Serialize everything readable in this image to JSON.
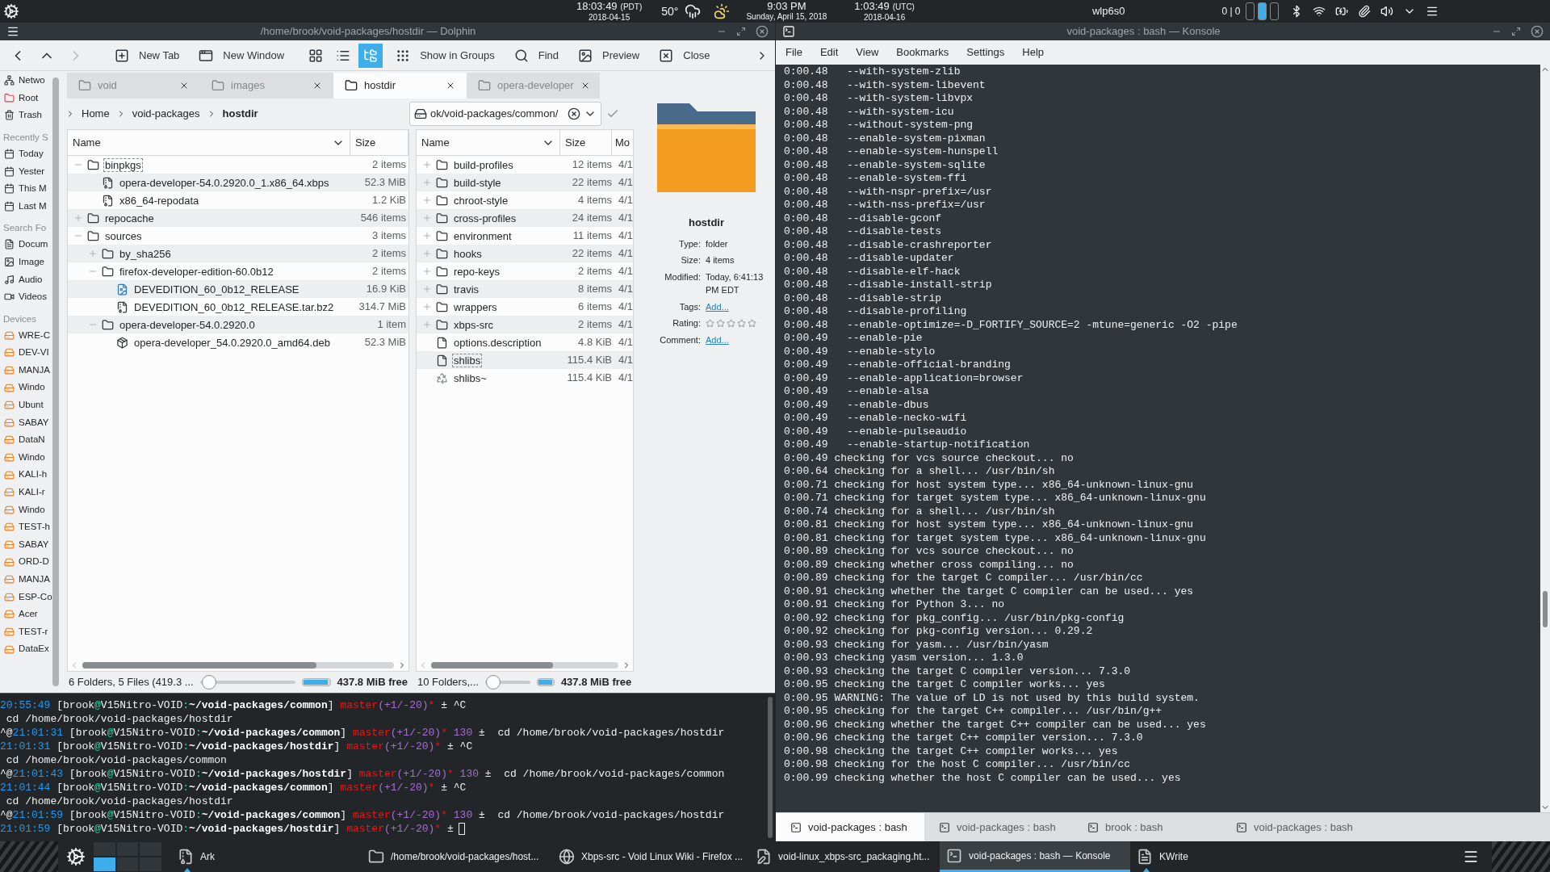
{
  "top_panel": {
    "clocks": [
      {
        "time": "18:03:49",
        "zone": "(PDT)",
        "date": "2018-04-15"
      },
      {
        "time": "9:03 PM",
        "date": "Sunday, April 15, 2018"
      },
      {
        "time": "1:03:49",
        "zone": "(UTC)",
        "date": "2018-04-16"
      }
    ],
    "weather": {
      "temperature": "50°"
    },
    "network": {
      "interface": "wlp6s0",
      "traffic": "0 | 0"
    },
    "pager": [
      {
        "selected": false
      },
      {
        "selected": true
      },
      {
        "selected": false
      }
    ]
  },
  "dolphin": {
    "title": "/home/brook/void-packages/hostdir — Dolphin",
    "nav": [
      {
        "kind": "back",
        "disabled": false
      },
      {
        "kind": "up",
        "disabled": false
      },
      {
        "kind": "forward",
        "disabled": true
      }
    ],
    "actions": [
      {
        "kind": "new_tab",
        "label": "New Tab"
      },
      {
        "kind": "new_window",
        "label": "New Window"
      }
    ],
    "view_modes": [
      {
        "kind": "icons",
        "selected": false
      },
      {
        "kind": "compact",
        "selected": false
      },
      {
        "kind": "tree",
        "selected": true
      }
    ],
    "actions_after": [
      {
        "kind": "groups",
        "label": "Show in Groups"
      },
      {
        "kind": "find",
        "label": "Find"
      },
      {
        "kind": "preview",
        "label": "Preview"
      },
      {
        "kind": "close",
        "label": "Close"
      }
    ],
    "sidebar": [
      {
        "items": [
          {
            "kind": "network",
            "label": "Netwo"
          },
          {
            "kind": "root",
            "label": "Root"
          },
          {
            "kind": "trash",
            "label": "Trash"
          }
        ]
      },
      {
        "heading": "Recently S",
        "items": [
          {
            "kind": "date",
            "label": "Today"
          },
          {
            "kind": "date",
            "label": "Yester"
          },
          {
            "kind": "date",
            "label": "This M"
          },
          {
            "kind": "date",
            "label": "Last M"
          }
        ]
      },
      {
        "heading": "Search Fo",
        "items": [
          {
            "kind": "documents",
            "label": "Docum"
          },
          {
            "kind": "images",
            "label": "Image"
          },
          {
            "kind": "audio",
            "label": "Audio"
          },
          {
            "kind": "videos",
            "label": "Videos"
          }
        ]
      },
      {
        "heading": "Devices",
        "items": [
          {
            "kind": "drive",
            "label": "WRE-C"
          },
          {
            "kind": "drive",
            "label": "DEV-VI"
          },
          {
            "kind": "drive",
            "label": "MANJA"
          },
          {
            "kind": "drive",
            "label": "Windo"
          },
          {
            "kind": "drive",
            "label": "Ubunt"
          },
          {
            "kind": "drive",
            "label": "SABAY"
          },
          {
            "kind": "drive",
            "label": "DataN"
          },
          {
            "kind": "drive",
            "label": "Windo"
          },
          {
            "kind": "drive",
            "label": "KALI-h"
          },
          {
            "kind": "drive",
            "label": "KALI-r"
          },
          {
            "kind": "drive",
            "label": "Windo"
          },
          {
            "kind": "drive",
            "label": "TEST-h"
          },
          {
            "kind": "drive",
            "label": "SABAY"
          },
          {
            "kind": "drive",
            "label": "ORD-D"
          },
          {
            "kind": "drive",
            "label": "MANJA"
          },
          {
            "kind": "drive",
            "label": "ESP-Co"
          },
          {
            "kind": "drive",
            "label": "Acer"
          },
          {
            "kind": "drive",
            "label": "TEST-r"
          },
          {
            "kind": "drive",
            "label": "DataEx"
          }
        ]
      }
    ],
    "tabs": [
      {
        "label": "void",
        "selected": false
      },
      {
        "label": "images",
        "selected": false
      },
      {
        "label": "hostdir",
        "selected": true
      },
      {
        "label": "opera-developer",
        "selected": false
      }
    ],
    "left_pane": {
      "breadcrumb": [
        {
          "label": "Home",
          "current": false
        },
        {
          "label": "void-packages",
          "current": false
        },
        {
          "label": "hostdir",
          "current": true
        }
      ],
      "columns": [
        "Name",
        "Size"
      ],
      "rows": [
        {
          "kind": "folder",
          "name": "binpkgs",
          "size": "2 items",
          "expanded": true,
          "focused": true,
          "children": [
            {
              "kind": "archive",
              "name": "opera-developer-54.0.2920.0_1.x86_64.xbps",
              "size": "52.3 MiB",
              "focused": false
            },
            {
              "kind": "archive",
              "name": "x86_64-repodata",
              "size": "1.2 KiB",
              "focused": false
            }
          ]
        },
        {
          "kind": "folder",
          "name": "repocache",
          "size": "546 items",
          "expanded": false,
          "focused": false
        },
        {
          "kind": "folder",
          "name": "sources",
          "size": "3 items",
          "expanded": true,
          "focused": false,
          "children": [
            {
              "kind": "folder",
              "name": "by_sha256",
              "size": "2 items",
              "expanded": false,
              "focused": false
            },
            {
              "kind": "folder",
              "name": "firefox-developer-edition-60.0b12",
              "size": "2 items",
              "expanded": true,
              "focused": false,
              "children": [
                {
                  "kind": "image",
                  "name": "DEVEDITION_60_0b12_RELEASE",
                  "size": "16.9 KiB",
                  "focused": false
                },
                {
                  "kind": "archive",
                  "name": "DEVEDITION_60_0b12_RELEASE.tar.bz2",
                  "size": "314.7 MiB",
                  "focused": false
                }
              ]
            },
            {
              "kind": "folder",
              "name": "opera-developer-54.0.2920.0",
              "size": "1 item",
              "expanded": true,
              "focused": false,
              "children": [
                {
                  "kind": "package",
                  "name": "opera-developer_54.0.2920.0_amd64.deb",
                  "size": "52.3 MiB",
                  "focused": false
                }
              ]
            }
          ]
        }
      ],
      "status": {
        "text": "6 Folders, 5 Files (419.3 ...",
        "zoom_slider": {
          "level": 0.02
        },
        "free_space": {
          "text": "437.8 MiB free",
          "level": 0.96
        }
      }
    },
    "right_pane": {
      "location": "ok/void-packages/common/",
      "columns": [
        "Name",
        "Size",
        "Mo"
      ],
      "rows": [
        {
          "kind": "folder",
          "name": "build-profiles",
          "size": "12 items",
          "modified": "4/1",
          "expanded": false,
          "focused": false
        },
        {
          "kind": "folder",
          "name": "build-style",
          "size": "22 items",
          "modified": "4/1",
          "expanded": false,
          "focused": false
        },
        {
          "kind": "folder",
          "name": "chroot-style",
          "size": "4 items",
          "modified": "4/1",
          "expanded": false,
          "focused": false
        },
        {
          "kind": "folder",
          "name": "cross-profiles",
          "size": "24 items",
          "modified": "4/1",
          "expanded": false,
          "focused": false
        },
        {
          "kind": "folder",
          "name": "environment",
          "size": "11 items",
          "modified": "4/1",
          "expanded": false,
          "focused": false
        },
        {
          "kind": "folder",
          "name": "hooks",
          "size": "22 items",
          "modified": "4/1",
          "expanded": false,
          "focused": false
        },
        {
          "kind": "folder",
          "name": "repo-keys",
          "size": "2 items",
          "modified": "4/1",
          "expanded": false,
          "focused": false
        },
        {
          "kind": "folder",
          "name": "travis",
          "size": "8 items",
          "modified": "4/1",
          "expanded": false,
          "focused": false
        },
        {
          "kind": "folder",
          "name": "wrappers",
          "size": "6 items",
          "modified": "4/1",
          "expanded": false,
          "focused": false
        },
        {
          "kind": "folder",
          "name": "xbps-src",
          "size": "2 items",
          "modified": "4/1",
          "expanded": false,
          "focused": false
        },
        {
          "kind": "file",
          "name": "options.description",
          "size": "4.8 KiB",
          "modified": "4/1",
          "focused": false
        },
        {
          "kind": "file",
          "name": "shlibs",
          "size": "115.4 KiB",
          "modified": "4/1",
          "focused": true
        },
        {
          "kind": "backup",
          "name": "shlibs~",
          "size": "115.4 KiB",
          "modified": "4/1",
          "focused": false
        }
      ],
      "status": {
        "text": "10 Folders,...",
        "zoom_slider": {
          "level": 0.02
        },
        "free_space": {
          "text": "437.8 MiB free",
          "level": 0.96
        }
      }
    },
    "info": {
      "name": "hostdir",
      "fields": [
        {
          "kind": "text",
          "label": "Type:",
          "value": "folder"
        },
        {
          "kind": "text",
          "label": "Size:",
          "value": "4 items"
        },
        {
          "kind": "text",
          "label": "Modified:",
          "value": "Today, 6:41:13 PM EDT"
        },
        {
          "kind": "link",
          "label": "Tags:",
          "value": "Add..."
        },
        {
          "kind": "rating",
          "label": "Rating:",
          "stars": 0
        },
        {
          "kind": "link",
          "label": "Comment:",
          "value": "Add..."
        }
      ]
    },
    "terminal": {
      "cursor_visible": true,
      "lines": [
        {
          "segments": [
            {
              "kind": "time",
              "text": "20:55:49"
            },
            {
              "kind": "plain",
              "text": " [brook"
            },
            {
              "kind": "accent",
              "text": "@"
            },
            {
              "kind": "plain",
              "text": "V15Nitro-VOID"
            },
            {
              "kind": "accent",
              "text": ":"
            },
            {
              "kind": "path",
              "text": "~/void-packages/common"
            },
            {
              "kind": "plain",
              "text": "] "
            },
            {
              "kind": "git",
              "text": "master"
            },
            {
              "kind": "diff",
              "text": "(+1/-20)"
            },
            {
              "kind": "git",
              "text": "*"
            },
            {
              "kind": "plain",
              "text": " ± ^C"
            }
          ]
        },
        {
          "segments": [
            {
              "kind": "plain",
              "text": " cd /home/brook/void-packages/hostdir"
            }
          ]
        },
        {
          "segments": [
            {
              "kind": "plain",
              "text": "^@"
            },
            {
              "kind": "time",
              "text": "21:01:31"
            },
            {
              "kind": "plain",
              "text": " [brook"
            },
            {
              "kind": "accent",
              "text": "@"
            },
            {
              "kind": "plain",
              "text": "V15Nitro-VOID"
            },
            {
              "kind": "accent",
              "text": ":"
            },
            {
              "kind": "path",
              "text": "~/void-packages/common"
            },
            {
              "kind": "plain",
              "text": "] "
            },
            {
              "kind": "git",
              "text": "master"
            },
            {
              "kind": "diff",
              "text": "(+1/-20)"
            },
            {
              "kind": "git",
              "text": "*"
            },
            {
              "kind": "diff",
              "text": " 130"
            },
            {
              "kind": "plain",
              "text": " ±  cd /home/brook/void-packages/hostdir"
            }
          ]
        },
        {
          "segments": [
            {
              "kind": "time",
              "text": "21:01:31"
            },
            {
              "kind": "plain",
              "text": " [brook"
            },
            {
              "kind": "accent",
              "text": "@"
            },
            {
              "kind": "plain",
              "text": "V15Nitro-VOID"
            },
            {
              "kind": "accent",
              "text": ":"
            },
            {
              "kind": "path",
              "text": "~/void-packages/hostdir"
            },
            {
              "kind": "plain",
              "text": "] "
            },
            {
              "kind": "git",
              "text": "master"
            },
            {
              "kind": "diff",
              "text": "(+1/-20)"
            },
            {
              "kind": "git",
              "text": "*"
            },
            {
              "kind": "plain",
              "text": " ± ^C"
            }
          ]
        },
        {
          "segments": [
            {
              "kind": "plain",
              "text": " cd /home/brook/void-packages/common"
            }
          ]
        },
        {
          "segments": [
            {
              "kind": "plain",
              "text": "^@"
            },
            {
              "kind": "time",
              "text": "21:01:43"
            },
            {
              "kind": "plain",
              "text": " [brook"
            },
            {
              "kind": "accent",
              "text": "@"
            },
            {
              "kind": "plain",
              "text": "V15Nitro-VOID"
            },
            {
              "kind": "accent",
              "text": ":"
            },
            {
              "kind": "path",
              "text": "~/void-packages/hostdir"
            },
            {
              "kind": "plain",
              "text": "] "
            },
            {
              "kind": "git",
              "text": "master"
            },
            {
              "kind": "diff",
              "text": "(+1/-20)"
            },
            {
              "kind": "git",
              "text": "*"
            },
            {
              "kind": "diff",
              "text": " 130"
            },
            {
              "kind": "plain",
              "text": " ±  cd /home/brook/void-packages/common"
            }
          ]
        },
        {
          "segments": [
            {
              "kind": "time",
              "text": "21:01:44"
            },
            {
              "kind": "plain",
              "text": " [brook"
            },
            {
              "kind": "accent",
              "text": "@"
            },
            {
              "kind": "plain",
              "text": "V15Nitro-VOID"
            },
            {
              "kind": "accent",
              "text": ":"
            },
            {
              "kind": "path",
              "text": "~/void-packages/common"
            },
            {
              "kind": "plain",
              "text": "] "
            },
            {
              "kind": "git",
              "text": "master"
            },
            {
              "kind": "diff",
              "text": "(+1/-20)"
            },
            {
              "kind": "git",
              "text": "*"
            },
            {
              "kind": "plain",
              "text": " ± ^C"
            }
          ]
        },
        {
          "segments": [
            {
              "kind": "plain",
              "text": " cd /home/brook/void-packages/hostdir"
            }
          ]
        },
        {
          "segments": [
            {
              "kind": "plain",
              "text": "^@"
            },
            {
              "kind": "time",
              "text": "21:01:59"
            },
            {
              "kind": "plain",
              "text": " [brook"
            },
            {
              "kind": "accent",
              "text": "@"
            },
            {
              "kind": "plain",
              "text": "V15Nitro-VOID"
            },
            {
              "kind": "accent",
              "text": ":"
            },
            {
              "kind": "path",
              "text": "~/void-packages/common"
            },
            {
              "kind": "plain",
              "text": "] "
            },
            {
              "kind": "git",
              "text": "master"
            },
            {
              "kind": "diff",
              "text": "(+1/-20)"
            },
            {
              "kind": "git",
              "text": "*"
            },
            {
              "kind": "diff",
              "text": " 130"
            },
            {
              "kind": "plain",
              "text": " ±  cd /home/brook/void-packages/hostdir"
            }
          ]
        },
        {
          "segments": [
            {
              "kind": "time",
              "text": "21:01:59"
            },
            {
              "kind": "plain",
              "text": " [brook"
            },
            {
              "kind": "accent",
              "text": "@"
            },
            {
              "kind": "plain",
              "text": "V15Nitro-VOID"
            },
            {
              "kind": "accent",
              "text": ":"
            },
            {
              "kind": "path",
              "text": "~/void-packages/hostdir"
            },
            {
              "kind": "plain",
              "text": "] "
            },
            {
              "kind": "git",
              "text": "master"
            },
            {
              "kind": "diff",
              "text": "(+1/-20)"
            },
            {
              "kind": "git",
              "text": "*"
            },
            {
              "kind": "plain",
              "text": " ±"
            }
          ]
        }
      ]
    }
  },
  "konsole": {
    "title": "void-packages : bash — Konsole",
    "menu": [
      "File",
      "Edit",
      "View",
      "Bookmarks",
      "Settings",
      "Help"
    ],
    "lines": [
      "0:00.48   --with-system-zlib",
      "0:00.48   --with-system-libevent",
      "0:00.48   --with-system-libvpx",
      "0:00.48   --with-system-icu",
      "0:00.48   --without-system-png",
      "0:00.48   --enable-system-pixman",
      "0:00.48   --enable-system-hunspell",
      "0:00.48   --enable-system-sqlite",
      "0:00.48   --enable-system-ffi",
      "0:00.48   --with-nspr-prefix=/usr",
      "0:00.48   --with-nss-prefix=/usr",
      "0:00.48   --disable-gconf",
      "0:00.48   --disable-tests",
      "0:00.48   --disable-crashreporter",
      "0:00.48   --disable-updater",
      "0:00.48   --disable-elf-hack",
      "0:00.48   --disable-install-strip",
      "0:00.48   --disable-strip",
      "0:00.48   --disable-profiling",
      "0:00.48   --enable-optimize=-D_FORTIFY_SOURCE=2 -mtune=generic -O2 -pipe",
      "0:00.49   --enable-pie",
      "0:00.49   --enable-stylo",
      "0:00.49   --enable-official-branding",
      "0:00.49   --enable-application=browser",
      "0:00.49   --enable-alsa",
      "0:00.49   --enable-dbus",
      "0:00.49   --enable-necko-wifi",
      "0:00.49   --enable-pulseaudio",
      "0:00.49   --enable-startup-notification",
      "0:00.49 checking for vcs source checkout... no",
      "0:00.64 checking for a shell... /usr/bin/sh",
      "0:00.71 checking for host system type... x86_64-unknown-linux-gnu",
      "0:00.71 checking for target system type... x86_64-unknown-linux-gnu",
      "0:00.74 checking for a shell... /usr/bin/sh",
      "0:00.81 checking for host system type... x86_64-unknown-linux-gnu",
      "0:00.81 checking for target system type... x86_64-unknown-linux-gnu",
      "0:00.89 checking for vcs source checkout... no",
      "0:00.89 checking whether cross compiling... no",
      "0:00.89 checking for the target C compiler... /usr/bin/cc",
      "0:00.91 checking whether the target C compiler can be used... yes",
      "0:00.91 checking for Python 3... no",
      "0:00.92 checking for pkg_config... /usr/bin/pkg-config",
      "0:00.92 checking for pkg-config version... 0.29.2",
      "0:00.93 checking for yasm... /usr/bin/yasm",
      "0:00.93 checking yasm version... 1.3.0",
      "0:00.93 checking the target C compiler version... 7.3.0",
      "0:00.95 checking the target C compiler works... yes",
      "0:00.95 WARNING: The value of LD is not used by this build system.",
      "0:00.95 checking for the target C++ compiler... /usr/bin/g++",
      "0:00.96 checking whether the target C++ compiler can be used... yes",
      "0:00.96 checking the target C++ compiler version... 7.3.0",
      "0:00.98 checking the target C++ compiler works... yes",
      "0:00.98 checking for the host C compiler... /usr/bin/cc",
      "0:00.99 checking whether the host C compiler can be used... yes"
    ],
    "tabs": [
      {
        "label": "void-packages : bash",
        "selected": true
      },
      {
        "label": "void-packages : bash",
        "selected": false
      },
      {
        "label": "brook : bash",
        "selected": false
      },
      {
        "label": "void-packages : bash",
        "selected": false
      }
    ]
  },
  "taskbar": {
    "desktops": [
      {
        "selected": false
      },
      {
        "selected": false
      },
      {
        "selected": false
      },
      {
        "selected": true
      },
      {
        "selected": false
      },
      {
        "selected": false
      }
    ],
    "tasks": [
      {
        "kind": "archiver",
        "label": "Ark",
        "selected": false,
        "attention": true
      },
      {
        "kind": "folder",
        "label": "/home/brook/void-packages/host...",
        "selected": false,
        "attention": false
      },
      {
        "kind": "browser",
        "label": "Xbps-src - Void Linux Wiki - Firefox ...",
        "selected": false,
        "attention": false
      },
      {
        "kind": "document",
        "label": "void-linux_xbps-src_packaging.ht...",
        "selected": false,
        "attention": false
      },
      {
        "kind": "terminal",
        "label": "void-packages : bash — Konsole",
        "selected": true,
        "attention": false
      },
      {
        "kind": "editor",
        "label": "KWrite",
        "selected": false,
        "attention": true
      }
    ]
  }
}
